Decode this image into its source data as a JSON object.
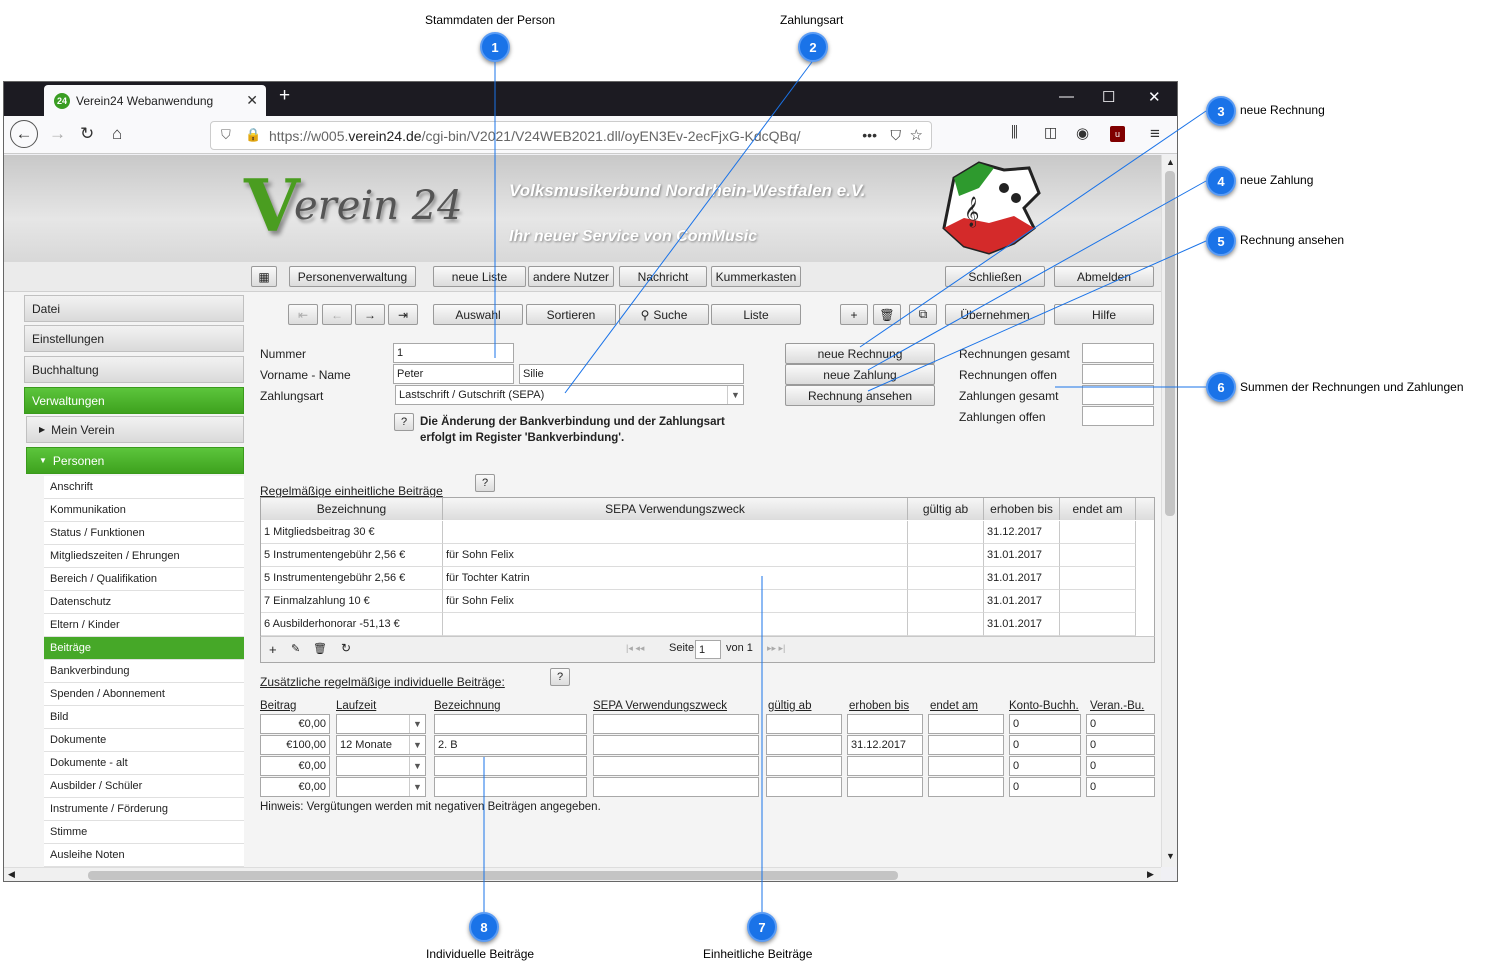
{
  "callouts": [
    {
      "num": "1",
      "text": "Stammdaten der Person"
    },
    {
      "num": "2",
      "text": "Zahlungsart"
    },
    {
      "num": "3",
      "text": "neue Rechnung"
    },
    {
      "num": "4",
      "text": "neue Zahlung"
    },
    {
      "num": "5",
      "text": "Rechnung ansehen"
    },
    {
      "num": "6",
      "text": "Summen der Rechnungen und Zahlungen"
    },
    {
      "num": "7",
      "text": "Einheitliche Beiträge"
    },
    {
      "num": "8",
      "text": "Individuelle Beiträge"
    }
  ],
  "browser": {
    "tab_title": "Verein24 Webanwendung",
    "favicon_text": "24",
    "url_prefix": "https://w005.",
    "url_domain": "verein24.de",
    "url_path": "/cgi-bin/V2021/V24WEB2021.dll/oyEN3Ev-2ecFjxG-KdcQBq/",
    "url_more": "•••"
  },
  "banner": {
    "logo_v": "V",
    "logo_text": "erein 24",
    "line1": "Volksmusikerbund Nordrhein-Westfalen e.V.",
    "line2": "Ihr neuer Service von ComMusic"
  },
  "menubar": {
    "personenverwaltung": "Personenverwaltung",
    "neue_liste": "neue Liste",
    "andere_nutzer": "andere Nutzer",
    "nachricht": "Nachricht",
    "kummerkasten": "Kummerkasten",
    "schliessen": "Schließen",
    "abmelden": "Abmelden"
  },
  "toolbar": {
    "auswahl": "Auswahl",
    "sortieren": "Sortieren",
    "suche": "Suche",
    "liste": "Liste",
    "uebernehmen": "Übernehmen",
    "hilfe": "Hilfe"
  },
  "sidebar": {
    "main": [
      "Datei",
      "Einstellungen",
      "Buchhaltung",
      "Verwaltungen"
    ],
    "mein_verein": "Mein Verein",
    "personen": "Personen",
    "items": [
      "Anschrift",
      "Kommunikation",
      "Status / Funktionen",
      "Mitgliedszeiten / Ehrungen",
      "Bereich / Qualifikation",
      "Datenschutz",
      "Eltern / Kinder",
      "Beiträge",
      "Bankverbindung",
      "Spenden / Abonnement",
      "Bild",
      "Dokumente",
      "Dokumente - alt",
      "Ausbilder / Schüler",
      "Instrumente / Förderung",
      "Stimme",
      "Ausleihe Noten"
    ]
  },
  "form": {
    "nummer_label": "Nummer",
    "nummer_value": "1",
    "name_label": "Vorname - Name",
    "vorname_value": "Peter",
    "nachname_value": "Silie",
    "zahlungsart_label": "Zahlungsart",
    "zahlungsart_value": "Lastschrift / Gutschrift (SEPA)",
    "hinweis_line1": "Die Änderung der Bankverbindung und der Zahlungsart",
    "hinweis_line2": "erfolgt im Register 'Bankverbindung'.",
    "help": "?"
  },
  "actions": {
    "neue_rechnung": "neue Rechnung",
    "neue_zahlung": "neue Zahlung",
    "rechnung_ansehen": "Rechnung ansehen"
  },
  "summen": {
    "rechnungen_gesamt": "Rechnungen gesamt",
    "rechnungen_offen": "Rechnungen offen",
    "zahlungen_gesamt": "Zahlungen gesamt",
    "zahlungen_offen": "Zahlungen offen"
  },
  "einheitlich": {
    "title": "Regelmäßige einheitliche Beiträge",
    "headers": [
      "Bezeichnung",
      "SEPA Verwendungszweck",
      "gültig ab",
      "erhoben bis",
      "endet am"
    ],
    "rows": [
      [
        "1 Mitgliedsbeitrag 30 €",
        "",
        "",
        "31.12.2017",
        ""
      ],
      [
        "5 Instrumentengebühr 2,56 €",
        "für Sohn Felix",
        "",
        "31.01.2017",
        ""
      ],
      [
        "5 Instrumentengebühr 2,56 €",
        "für Tochter Katrin",
        "",
        "31.01.2017",
        ""
      ],
      [
        "7 Einmalzahlung 10 €",
        "für Sohn Felix",
        "",
        "31.01.2017",
        ""
      ],
      [
        "6 Ausbilderhonorar -51,13 €",
        "",
        "",
        "31.01.2017",
        ""
      ]
    ],
    "pager_seite": "Seite",
    "pager_page": "1",
    "pager_von": "von 1"
  },
  "individuell": {
    "title": "Zusätzliche regelmäßige individuelle Beiträge:",
    "headers": [
      "Beitrag",
      "Laufzeit",
      "Bezeichnung",
      "SEPA Verwendungszweck",
      "gültig ab",
      "erhoben bis",
      "endet am",
      "Konto-Buchh.",
      "Veran.-Bu."
    ],
    "rows": [
      [
        "€0,00",
        "",
        "",
        "",
        "",
        "",
        "",
        "0",
        "0"
      ],
      [
        "€100,00",
        "12 Monate",
        "2. B",
        "",
        "",
        "31.12.2017",
        "",
        "0",
        "0"
      ],
      [
        "€0,00",
        "",
        "",
        "",
        "",
        "",
        "",
        "0",
        "0"
      ],
      [
        "€0,00",
        "",
        "",
        "",
        "",
        "",
        "",
        "0",
        "0"
      ]
    ],
    "hinweis": "Hinweis: Vergütungen werden mit negativen Beiträgen angegeben."
  }
}
